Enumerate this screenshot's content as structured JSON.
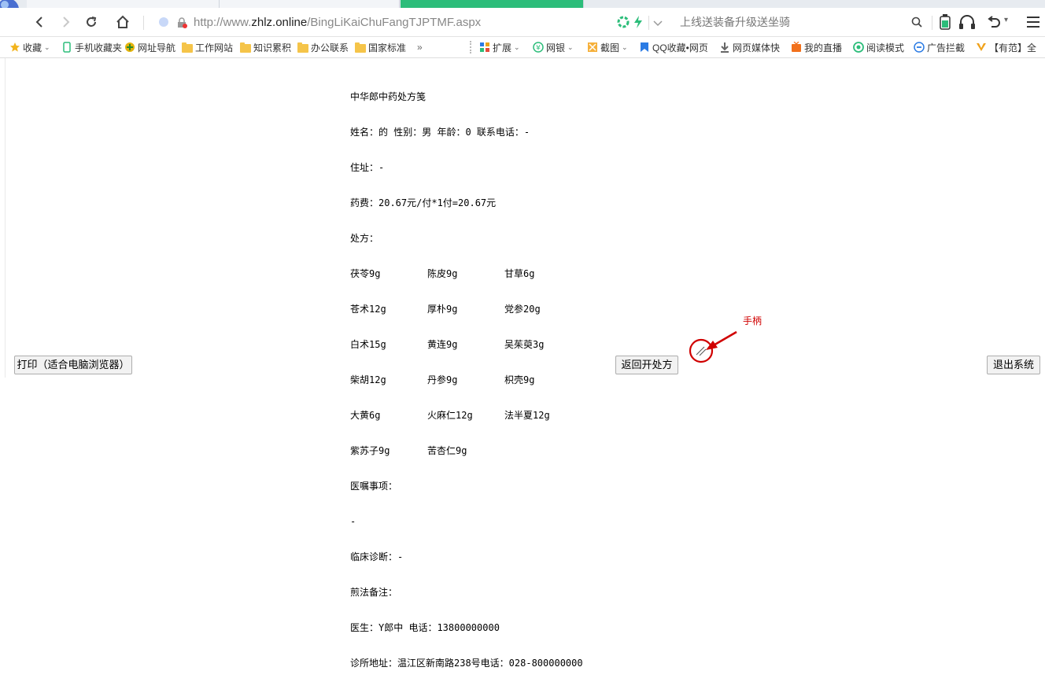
{
  "browser": {
    "url_prefix": "http://www.",
    "url_host": "zhlz.online",
    "url_path": "/BingLiKaiChuFangTJPTMF.aspx",
    "search_placeholder": "上线送装备升级送坐骑",
    "accent_color": "#2cbd7a"
  },
  "bookmarks": [
    {
      "label": "收藏",
      "icon": "star-icon",
      "caret": true
    },
    {
      "label": "手机收藏夹",
      "icon": "phone-icon"
    },
    {
      "label": "网址导航",
      "icon": "nav-icon"
    },
    {
      "label": "工作网站",
      "icon": "folder-icon"
    },
    {
      "label": "知识累积",
      "icon": "folder-icon"
    },
    {
      "label": "办公联系",
      "icon": "folder-icon"
    },
    {
      "label": "国家标准",
      "icon": "folder-icon"
    },
    {
      "label": "»",
      "icon": ""
    },
    {
      "label": "扩展",
      "icon": "grid-icon",
      "caret": true
    },
    {
      "label": "网银",
      "icon": "bank-icon",
      "caret": true
    },
    {
      "label": "截图",
      "icon": "scissors-icon",
      "caret": true
    },
    {
      "label": "QQ收藏•网页",
      "icon": "bookmark-icon"
    },
    {
      "label": "网页媒体快",
      "icon": "download-icon"
    },
    {
      "label": "我的直播",
      "icon": "tv-icon"
    },
    {
      "label": "阅读模式",
      "icon": "reader-icon"
    },
    {
      "label": "广告拦截",
      "icon": "block-icon"
    },
    {
      "label": "【有范】全",
      "icon": "fan-icon"
    }
  ],
  "prescription": {
    "title": "中华郎中药处方笺",
    "patient_line": "姓名：的 性别：男 年龄：0 联系电话：-",
    "address_line": "住址：-",
    "fee_line": "药费：20.67元/付*1付=20.67元",
    "rx_label": "处方：",
    "herb_rows": [
      [
        "茯苓9g",
        "陈皮9g",
        "甘草6g"
      ],
      [
        "苍术12g",
        "厚朴9g",
        "党参20g"
      ],
      [
        "白术15g",
        "黄连9g",
        "吴茱萸3g"
      ],
      [
        "柴胡12g",
        "丹参9g",
        "枳壳9g"
      ],
      [
        "大黄6g",
        "火麻仁12g",
        "法半夏12g"
      ],
      [
        "紫苏子9g",
        "苦杏仁9g"
      ]
    ],
    "advice_label": "医嘱事项：",
    "advice_value": "-",
    "diagnosis_line": "临床诊断：-",
    "decoction_line": "煎法备注：",
    "doctor_line": "医生：Y郎中 电话：13800000000",
    "clinic_line": "诊所地址：温江区新南路238号电话：028-800000000"
  },
  "buttons": {
    "print_label": "打印（适合电脑浏览器）",
    "back_label": "返回开处方",
    "exit_label": "退出系统"
  },
  "annotation": {
    "handle_label": "手柄",
    "color": "#d00000"
  }
}
